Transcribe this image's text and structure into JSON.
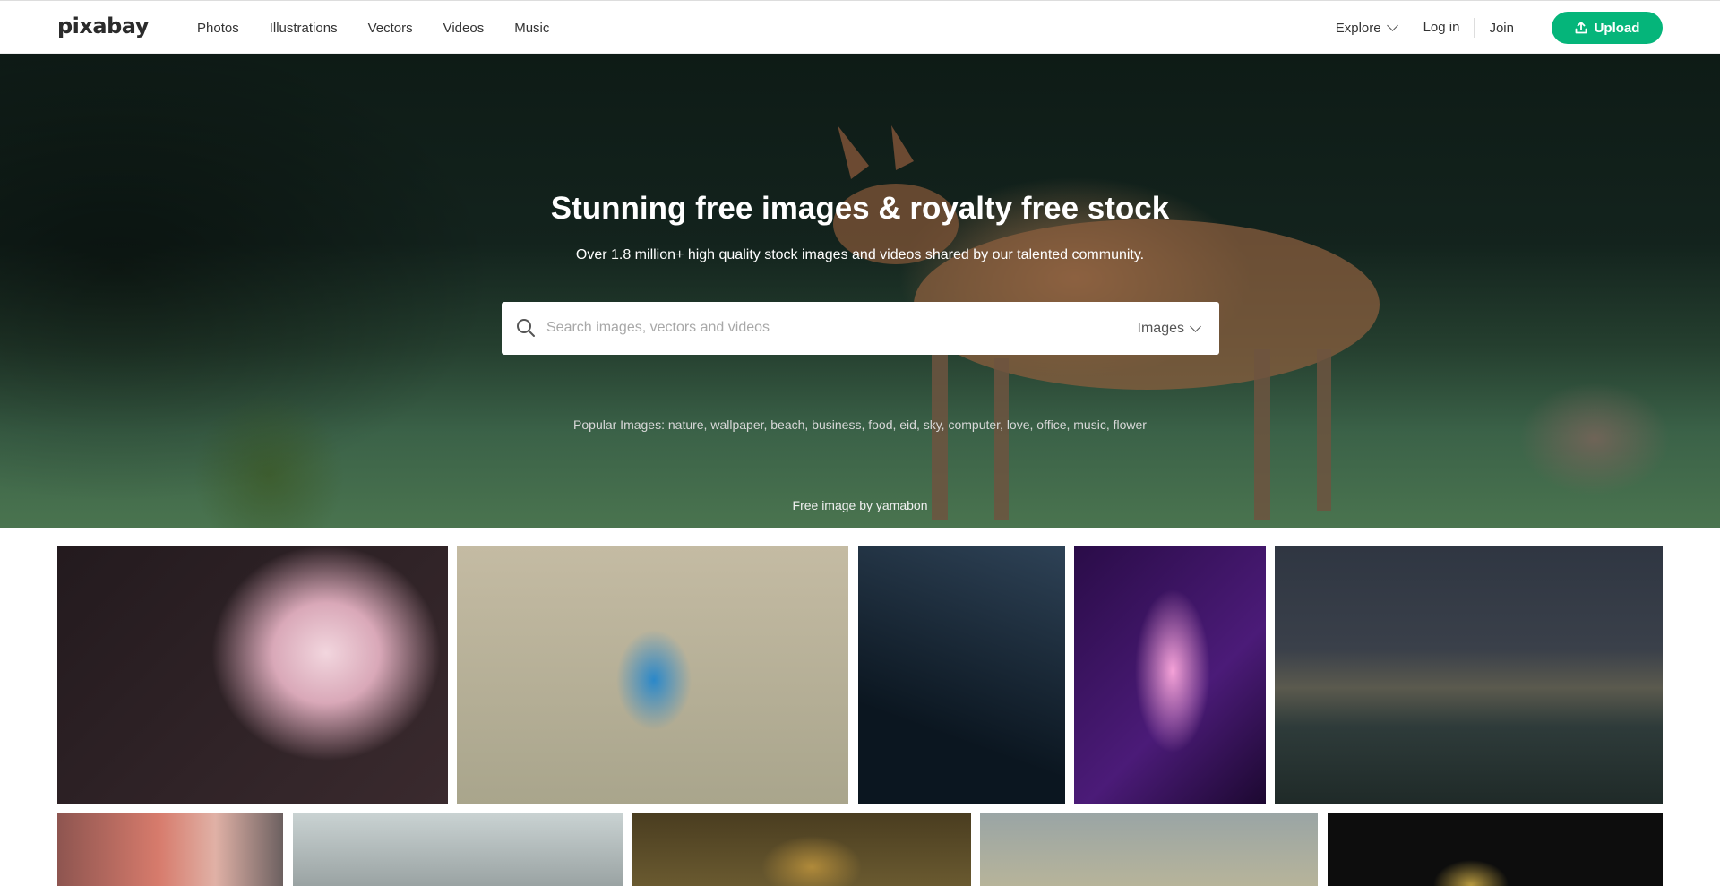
{
  "header": {
    "logo": "pixabay",
    "nav": [
      "Photos",
      "Illustrations",
      "Vectors",
      "Videos",
      "Music"
    ],
    "explore_label": "Explore",
    "login_label": "Log in",
    "join_label": "Join",
    "upload_label": "Upload",
    "accent_color": "#05b57a"
  },
  "hero": {
    "title": "Stunning free images & royalty free stock",
    "subtitle": "Over 1.8 million+ high quality stock images and videos shared by our talented community.",
    "search": {
      "placeholder": "Search images, vectors and videos",
      "type_label": "Images"
    },
    "popular": "Popular Images: nature, wallpaper, beach, business, food, eid, sky, computer, love, office, music, flower",
    "credit": "Free image by yamabon"
  },
  "icons": {
    "search": "search-icon",
    "upload": "upload-icon",
    "explore_chevron": "chevron-down-icon",
    "search_type_chevron": "chevron-down-icon"
  }
}
